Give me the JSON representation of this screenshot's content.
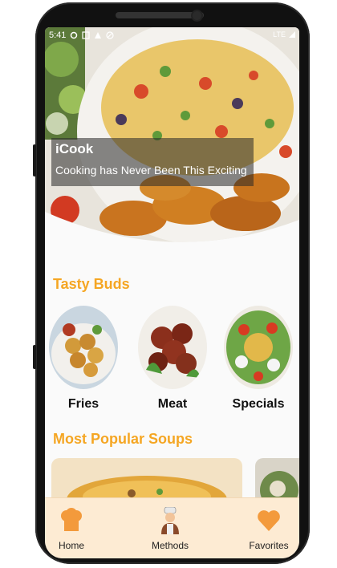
{
  "status_bar": {
    "time": "5:41",
    "network": "LTE"
  },
  "hero": {
    "title": "iCook",
    "subtitle": "Cooking has Never Been This Exciting"
  },
  "sections": {
    "tasty_buds_title": "Tasty Buds",
    "popular_soups_title": "Most Popular Soups"
  },
  "categories": [
    {
      "label": "Fries",
      "icon": "fries-image"
    },
    {
      "label": "Meat",
      "icon": "meat-image"
    },
    {
      "label": "Specials",
      "icon": "specials-image"
    }
  ],
  "bottom_nav": {
    "items": [
      {
        "label": "Home",
        "icon": "chef-hat-icon"
      },
      {
        "label": "Methods",
        "icon": "chef-icon"
      },
      {
        "label": "Favorites",
        "icon": "heart-icon"
      }
    ]
  },
  "colors": {
    "accent": "#f5a623",
    "nav_background": "#fdebd3",
    "icon_orange": "#f39a3c"
  }
}
